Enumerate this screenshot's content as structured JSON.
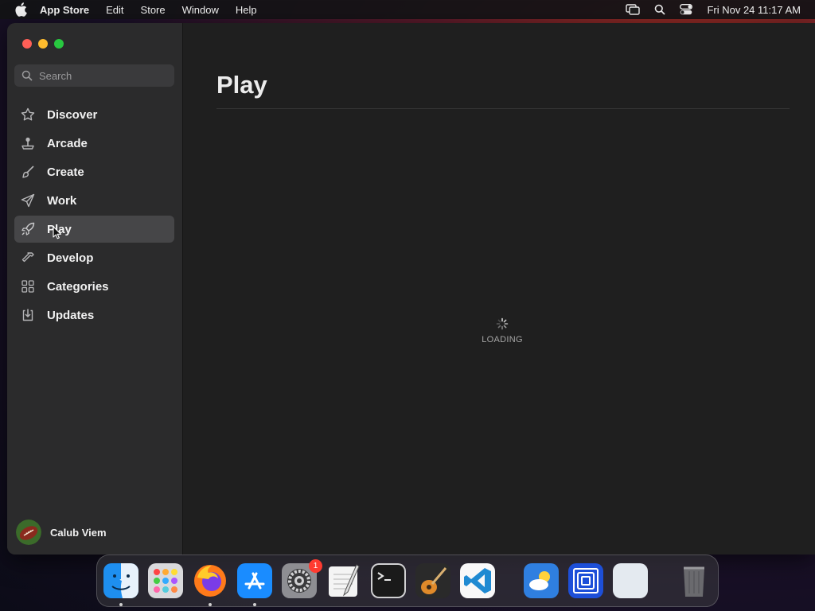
{
  "menubar": {
    "app_name": "App Store",
    "menus": [
      "Edit",
      "Store",
      "Window",
      "Help"
    ],
    "datetime": "Fri Nov 24  11:17 AM"
  },
  "sidebar": {
    "search_placeholder": "Search",
    "items": [
      {
        "label": "Discover",
        "icon": "star-icon"
      },
      {
        "label": "Arcade",
        "icon": "joystick-icon"
      },
      {
        "label": "Create",
        "icon": "paintbrush-icon"
      },
      {
        "label": "Work",
        "icon": "paperplane-icon"
      },
      {
        "label": "Play",
        "icon": "rocket-icon",
        "active": true
      },
      {
        "label": "Develop",
        "icon": "hammer-icon"
      },
      {
        "label": "Categories",
        "icon": "grid-icon"
      },
      {
        "label": "Updates",
        "icon": "download-icon"
      }
    ],
    "user_name": "Calub Viem"
  },
  "main": {
    "title": "Play",
    "loading_text": "LOADING"
  },
  "dock": {
    "apps": [
      "Finder",
      "Launchpad",
      "Firefox",
      "App Store",
      "System Settings",
      "TextEdit",
      "Terminal",
      "GarageBand",
      "Visual Studio Code",
      "Weather",
      "Screen Sharing",
      "Preview",
      "Trash"
    ],
    "settings_badge": "1"
  },
  "colors": {
    "close": "#fe5f57",
    "minimize": "#febc2e",
    "maximize": "#28c840",
    "active_item": "#464648",
    "badge": "#ff3b30"
  }
}
